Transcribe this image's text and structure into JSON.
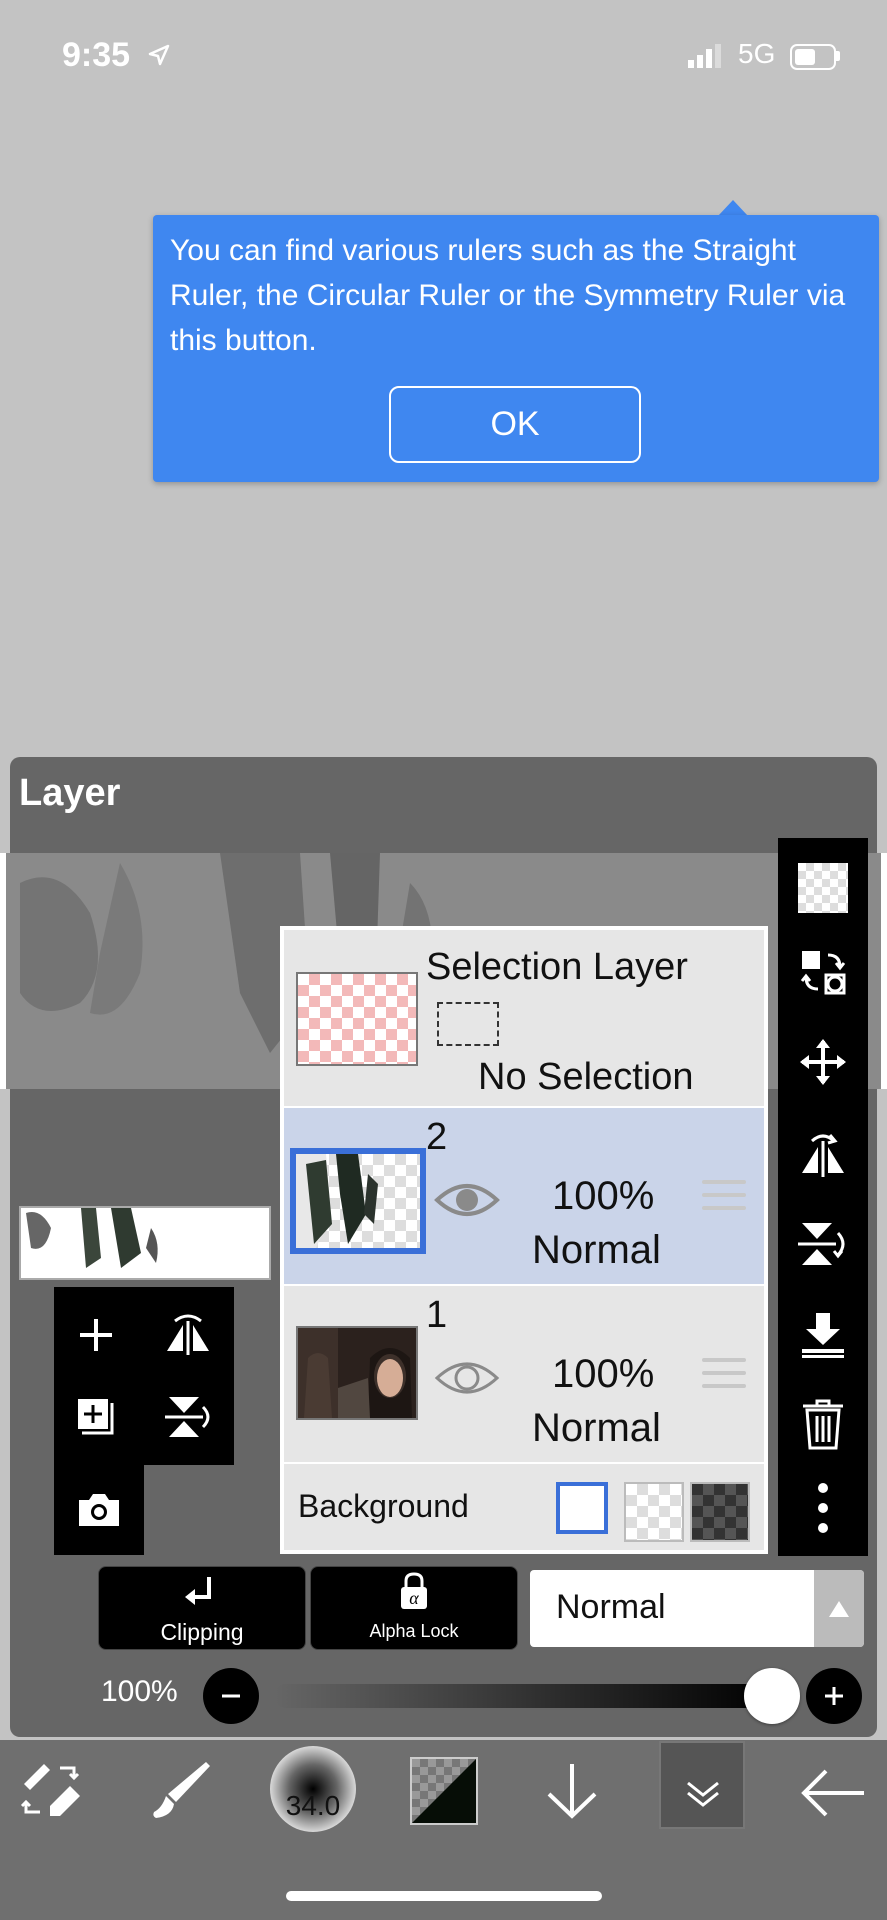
{
  "status_bar": {
    "time": "9:35",
    "network": "5G"
  },
  "tooltip": {
    "message": "You can find various rulers such as the Straight Ruler, the Circular Ruler or the Symmetry Ruler via this button.",
    "ok_label": "OK"
  },
  "panel": {
    "title": "Layer"
  },
  "selection_layer": {
    "title": "Selection Layer",
    "status": "No Selection"
  },
  "layers": [
    {
      "number": "2",
      "opacity": "100%",
      "blend": "Normal",
      "selected": true
    },
    {
      "number": "1",
      "opacity": "100%",
      "blend": "Normal",
      "selected": false
    }
  ],
  "background": {
    "label": "Background",
    "selected": "white"
  },
  "clipping_label": "Clipping",
  "alpha_lock_label": "Alpha Lock",
  "blend_mode": "Normal",
  "opacity": {
    "label": "100%",
    "value": 1.0
  },
  "brush_size": "34.0",
  "colors": {
    "accent": "#3f87f0",
    "selected_row": "#cad4e9"
  }
}
